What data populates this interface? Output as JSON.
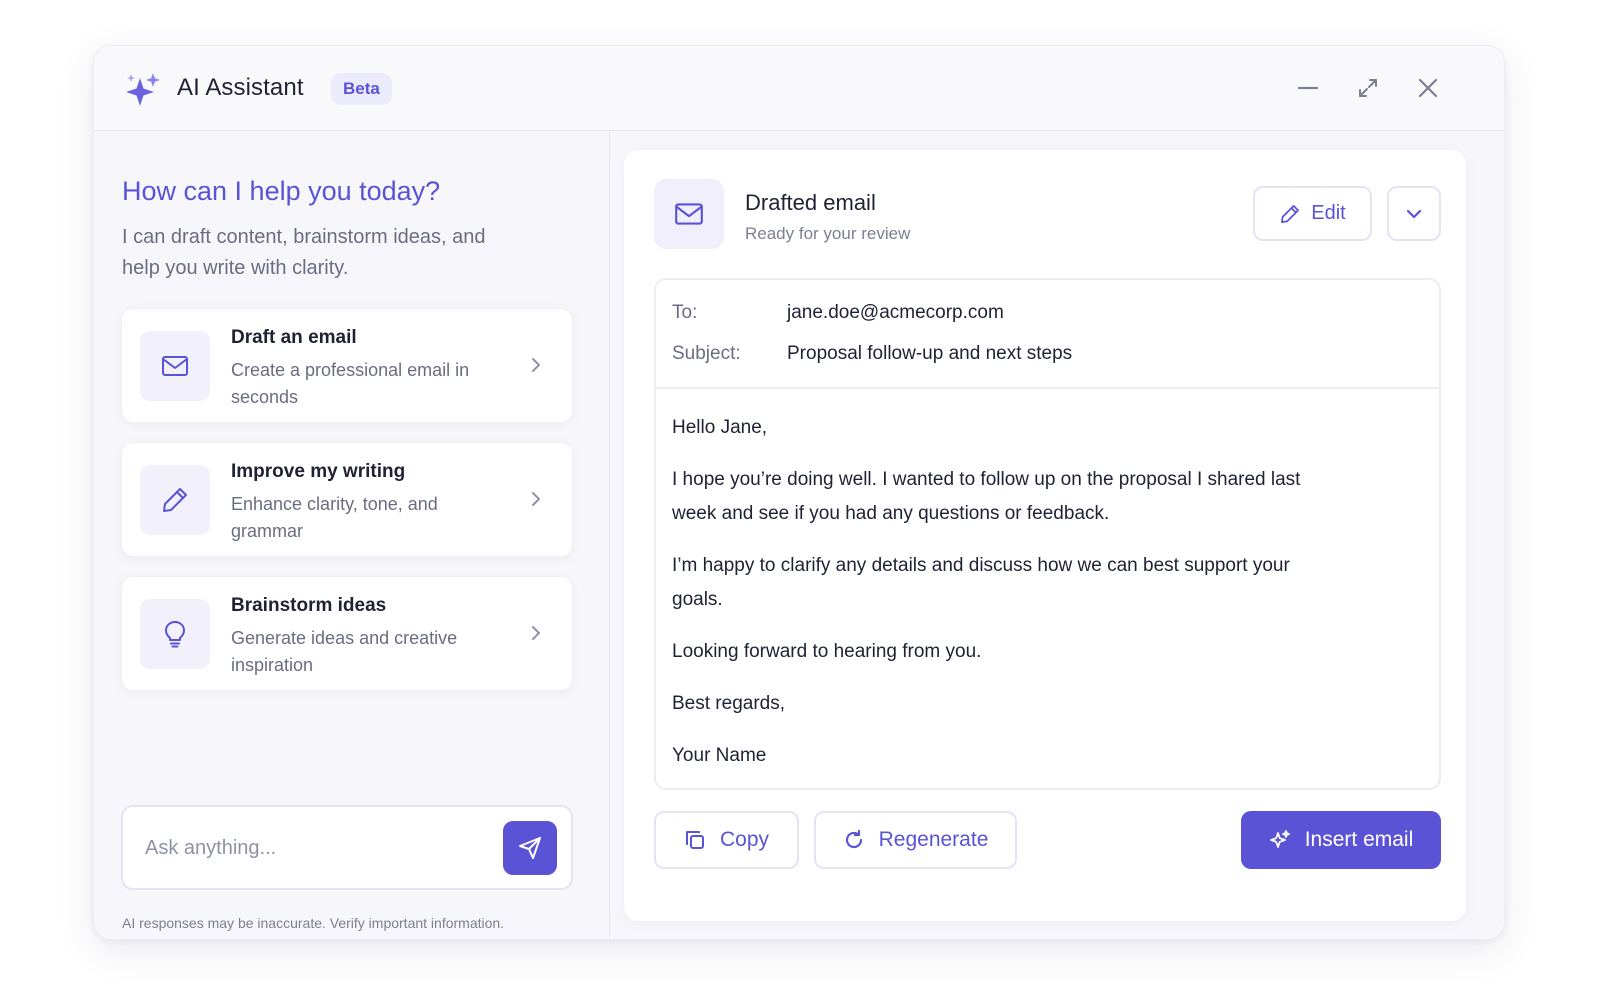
{
  "window": {
    "title": "AI Assistant",
    "badge": "Beta",
    "controls": [
      "minimize-icon",
      "maximize-icon",
      "close-icon"
    ]
  },
  "left": {
    "heading": "How can I help you today?",
    "subheading": "I can draft content, brainstorm ideas, and help you write with clarity.",
    "cards": [
      {
        "icon": "mail-icon",
        "title": "Draft an email",
        "desc": "Create a professional email in seconds"
      },
      {
        "icon": "pencil-icon",
        "title": "Improve my writing",
        "desc": "Enhance clarity, tone, and grammar"
      },
      {
        "icon": "lightbulb-icon",
        "title": "Brainstorm ideas",
        "desc": "Generate ideas and creative inspiration"
      }
    ],
    "ask_placeholder": "Ask anything...",
    "disclaimer": "AI responses may be inaccurate. Verify important information."
  },
  "right": {
    "title": "Drafted email",
    "subtitle": "Ready for your review",
    "edit_label": "Edit",
    "email": {
      "to_label": "To:",
      "to": "jane.doe@acmecorp.com",
      "subject_label": "Subject:",
      "subject": "Proposal follow-up and next steps",
      "body": [
        "Hello Jane,",
        "I hope you’re doing well. I wanted to follow up on the proposal I shared last week and see if you had any questions or feedback.",
        "I’m happy to clarify any details and discuss how we can best support your goals.",
        "Looking forward to hearing from you.",
        "Best regards,",
        "Your Name"
      ]
    },
    "actions": {
      "copy": "Copy",
      "regenerate": "Regenerate",
      "insert": "Insert email"
    }
  },
  "colors": {
    "accent": "#5b53d6",
    "accent_soft": "#ecebfb",
    "text": "#1f2233",
    "muted": "#6a6d80"
  }
}
